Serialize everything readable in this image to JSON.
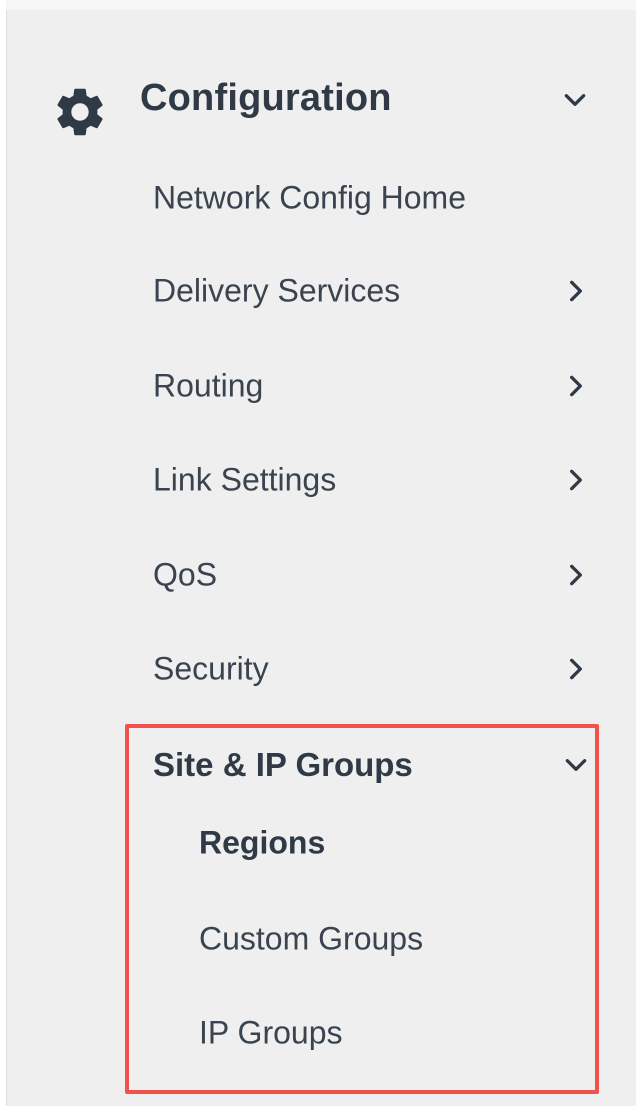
{
  "section": {
    "title": "Configuration",
    "icon": "gear-icon",
    "expanded_icon": "chevron-down-icon"
  },
  "nav": {
    "items": [
      {
        "label": "Network Config Home",
        "has_chevron": false
      },
      {
        "label": "Delivery Services",
        "has_chevron": true
      },
      {
        "label": "Routing",
        "has_chevron": true
      },
      {
        "label": "Link Settings",
        "has_chevron": true
      },
      {
        "label": "QoS",
        "has_chevron": true
      },
      {
        "label": "Security",
        "has_chevron": true
      }
    ]
  },
  "group": {
    "title": "Site & IP Groups",
    "expanded_icon": "chevron-down-icon",
    "highlight_color": "#f1534a",
    "items": [
      {
        "label": "Regions",
        "active": true
      },
      {
        "label": "Custom Groups",
        "active": false
      },
      {
        "label": "IP Groups",
        "active": false
      }
    ]
  },
  "colors": {
    "panel_bg": "#efefef",
    "text": "#2f3a46",
    "highlight": "#f1534a"
  }
}
